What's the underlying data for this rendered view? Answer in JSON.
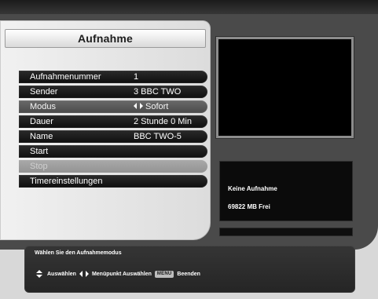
{
  "window": {
    "title": "Aufnahme"
  },
  "menu": {
    "items": [
      {
        "label": "Aufnahmenummer",
        "value": "1"
      },
      {
        "label": "Sender",
        "value": "3 BBC TWO"
      },
      {
        "label": "Modus",
        "value": "Sofort",
        "has_left_right_arrows": true
      },
      {
        "label": "Dauer",
        "value": "2 Stunde 0 Min"
      },
      {
        "label": "Name",
        "value": "BBC TWO-5"
      },
      {
        "label": "Start",
        "value": ""
      },
      {
        "label": "Stop",
        "value": ""
      },
      {
        "label": "Timereinstellungen",
        "value": ""
      }
    ]
  },
  "info": {
    "status": "Keine Aufnahme",
    "free": "69822 MB Frei"
  },
  "help": {
    "message": "Wählen Sie den Aufnahmemodus",
    "legend": {
      "select": "Auswählen",
      "menu_select": "Menüpunkt Auswählen",
      "menu_badge": "MENU",
      "exit": "Beenden"
    }
  }
}
